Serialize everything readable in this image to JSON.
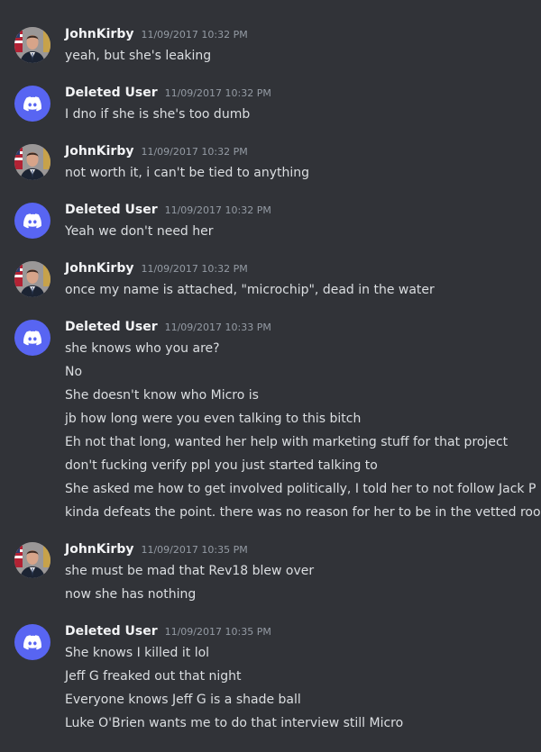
{
  "colors": {
    "background": "#313338",
    "username": "#f2f3f5",
    "timestamp": "#949ba4",
    "message": "#dbdee1",
    "discord_avatar": "#5865f2"
  },
  "messages": [
    {
      "author": "JohnKirby",
      "avatar": "user-photo-avatar",
      "timestamp": "11/09/2017 10:32 PM",
      "lines": [
        "yeah, but she's leaking"
      ]
    },
    {
      "author": "Deleted User",
      "avatar": "discord-default-avatar",
      "timestamp": "11/09/2017 10:32 PM",
      "lines": [
        "I dno if she is she's too dumb"
      ]
    },
    {
      "author": "JohnKirby",
      "avatar": "user-photo-avatar",
      "timestamp": "11/09/2017 10:32 PM",
      "lines": [
        "not worth it, i can't be tied to anything"
      ]
    },
    {
      "author": "Deleted User",
      "avatar": "discord-default-avatar",
      "timestamp": "11/09/2017 10:32 PM",
      "lines": [
        "Yeah we don't need her"
      ]
    },
    {
      "author": "JohnKirby",
      "avatar": "user-photo-avatar",
      "timestamp": "11/09/2017 10:32 PM",
      "lines": [
        "once my name is attached, \"microchip\", dead in the water"
      ]
    },
    {
      "author": "Deleted User",
      "avatar": "discord-default-avatar",
      "timestamp": "11/09/2017 10:33 PM",
      "lines": [
        "she knows who you are?",
        "No",
        "She doesn't know who Micro is",
        "jb how long were you even talking to this bitch",
        "Eh not that long, wanted her help with marketing stuff for that project",
        "don't fucking verify ppl you just started talking to",
        "She asked me how to get involved politically, I told her to not follow Jack P",
        "kinda defeats the point. there was no reason for her to be in the vetted room"
      ]
    },
    {
      "author": "JohnKirby",
      "avatar": "user-photo-avatar",
      "timestamp": "11/09/2017 10:35 PM",
      "lines": [
        "she must be mad that Rev18 blew over",
        "now she has nothing"
      ]
    },
    {
      "author": "Deleted User",
      "avatar": "discord-default-avatar",
      "timestamp": "11/09/2017 10:35 PM",
      "lines": [
        "She knows I killed it lol",
        "Jeff G freaked out that night",
        "Everyone knows Jeff G is a shade ball",
        "Luke O'Brien wants me to do that interview still Micro"
      ]
    }
  ]
}
